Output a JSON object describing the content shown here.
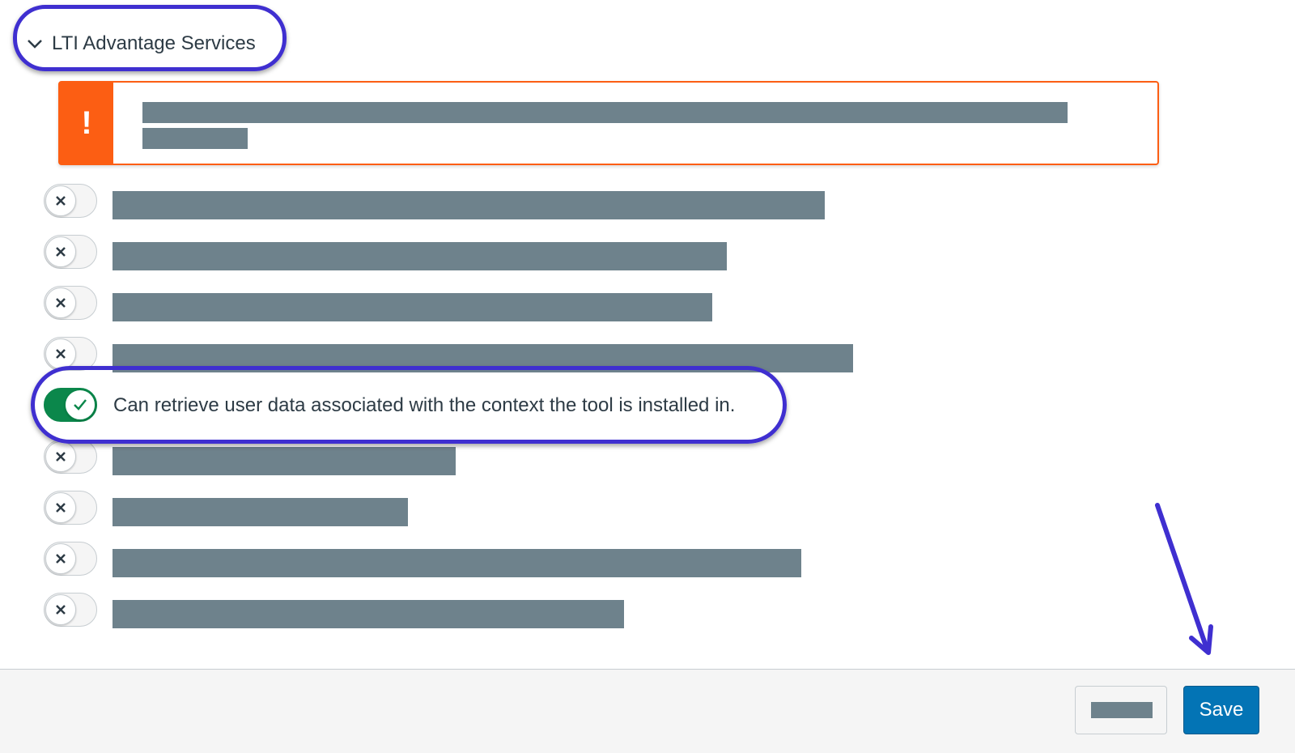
{
  "section": {
    "title": "LTI Advantage Services",
    "chevron_icon": "chevron-down-icon"
  },
  "alert": {
    "icon_text": "!",
    "icon": "warning-icon"
  },
  "services": [
    {
      "enabled": false,
      "label": ""
    },
    {
      "enabled": false,
      "label": ""
    },
    {
      "enabled": false,
      "label": ""
    },
    {
      "enabled": false,
      "label": ""
    },
    {
      "enabled": true,
      "label": "Can retrieve user data associated with the context the tool is installed in."
    },
    {
      "enabled": false,
      "label": ""
    },
    {
      "enabled": false,
      "label": ""
    },
    {
      "enabled": false,
      "label": ""
    },
    {
      "enabled": false,
      "label": ""
    }
  ],
  "footer": {
    "cancel_label": "",
    "save_label": "Save"
  },
  "colors": {
    "accent_blue": "#0374b5",
    "toggle_on": "#0b874b",
    "alert_orange": "#fc5e13",
    "annotation": "#3f2fd0",
    "redaction": "#6e828c"
  }
}
